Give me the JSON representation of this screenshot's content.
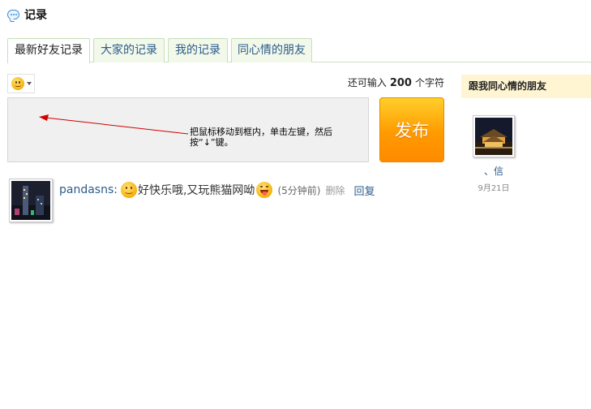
{
  "header": {
    "title": "记录",
    "icon": "speech-bubble-icon",
    "icon_color": "#3b8fd8"
  },
  "tabs": [
    {
      "label": "最新好友记录",
      "active": true
    },
    {
      "label": "大家的记录",
      "active": false
    },
    {
      "label": "我的记录",
      "active": false
    },
    {
      "label": "同心情的朋友",
      "active": false
    }
  ],
  "composer": {
    "emoji_icon": "smiley-icon",
    "counter_prefix": "还可输入",
    "counter_value": "200",
    "counter_suffix": "个字符",
    "hint_text": "把鼠标移动到框内，单击左键，然后按“↓”键。",
    "publish_label": "发布",
    "publish_color": "#ff9a00"
  },
  "record": {
    "username": "pandasns",
    "colon": ":",
    "text": "好快乐哦,又玩熊猫网呦",
    "time": "(5分钟前)",
    "delete_label": "删除",
    "reply_label": "回复"
  },
  "sidebar": {
    "title": "跟我同心情的朋友",
    "friends": [
      {
        "name": "、信",
        "date": "9月21日"
      }
    ]
  }
}
